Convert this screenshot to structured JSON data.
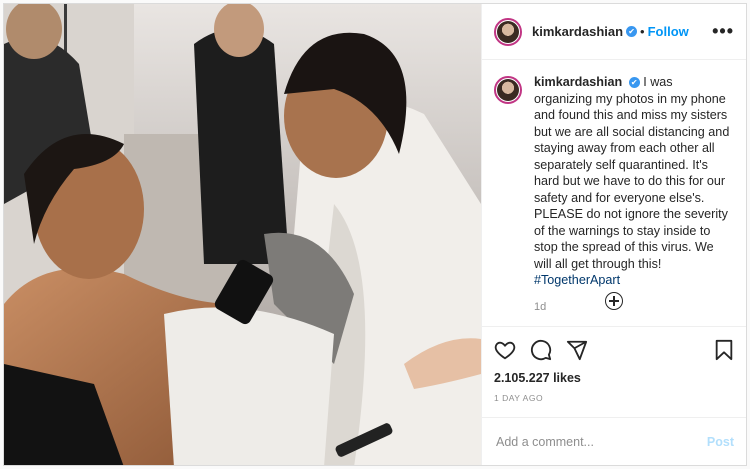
{
  "header": {
    "username": "kimkardashian",
    "separator": "•",
    "follow_label": "Follow",
    "more_label": "•••"
  },
  "caption": {
    "username": "kimkardashian",
    "text": "I was organizing my photos in my phone and found this and miss my sisters but we are all social distancing and staying away from each other all separately self quarantined. It's hard but we have to do this for our safety and for everyone else's. PLEASE do not ignore the severity of the warnings to stay inside to stop the spread of this virus. We will all get through this!",
    "hashtag": "#TogetherApart",
    "time": "1d"
  },
  "actions": {
    "likes": "2.105.227 likes",
    "time_ago": "1 DAY AGO"
  },
  "comment": {
    "placeholder": "Add a comment...",
    "post_label": "Post"
  },
  "colors": {
    "accent": "#0095f6",
    "verified": "#3897f0",
    "post_disabled": "#b2dffc"
  }
}
